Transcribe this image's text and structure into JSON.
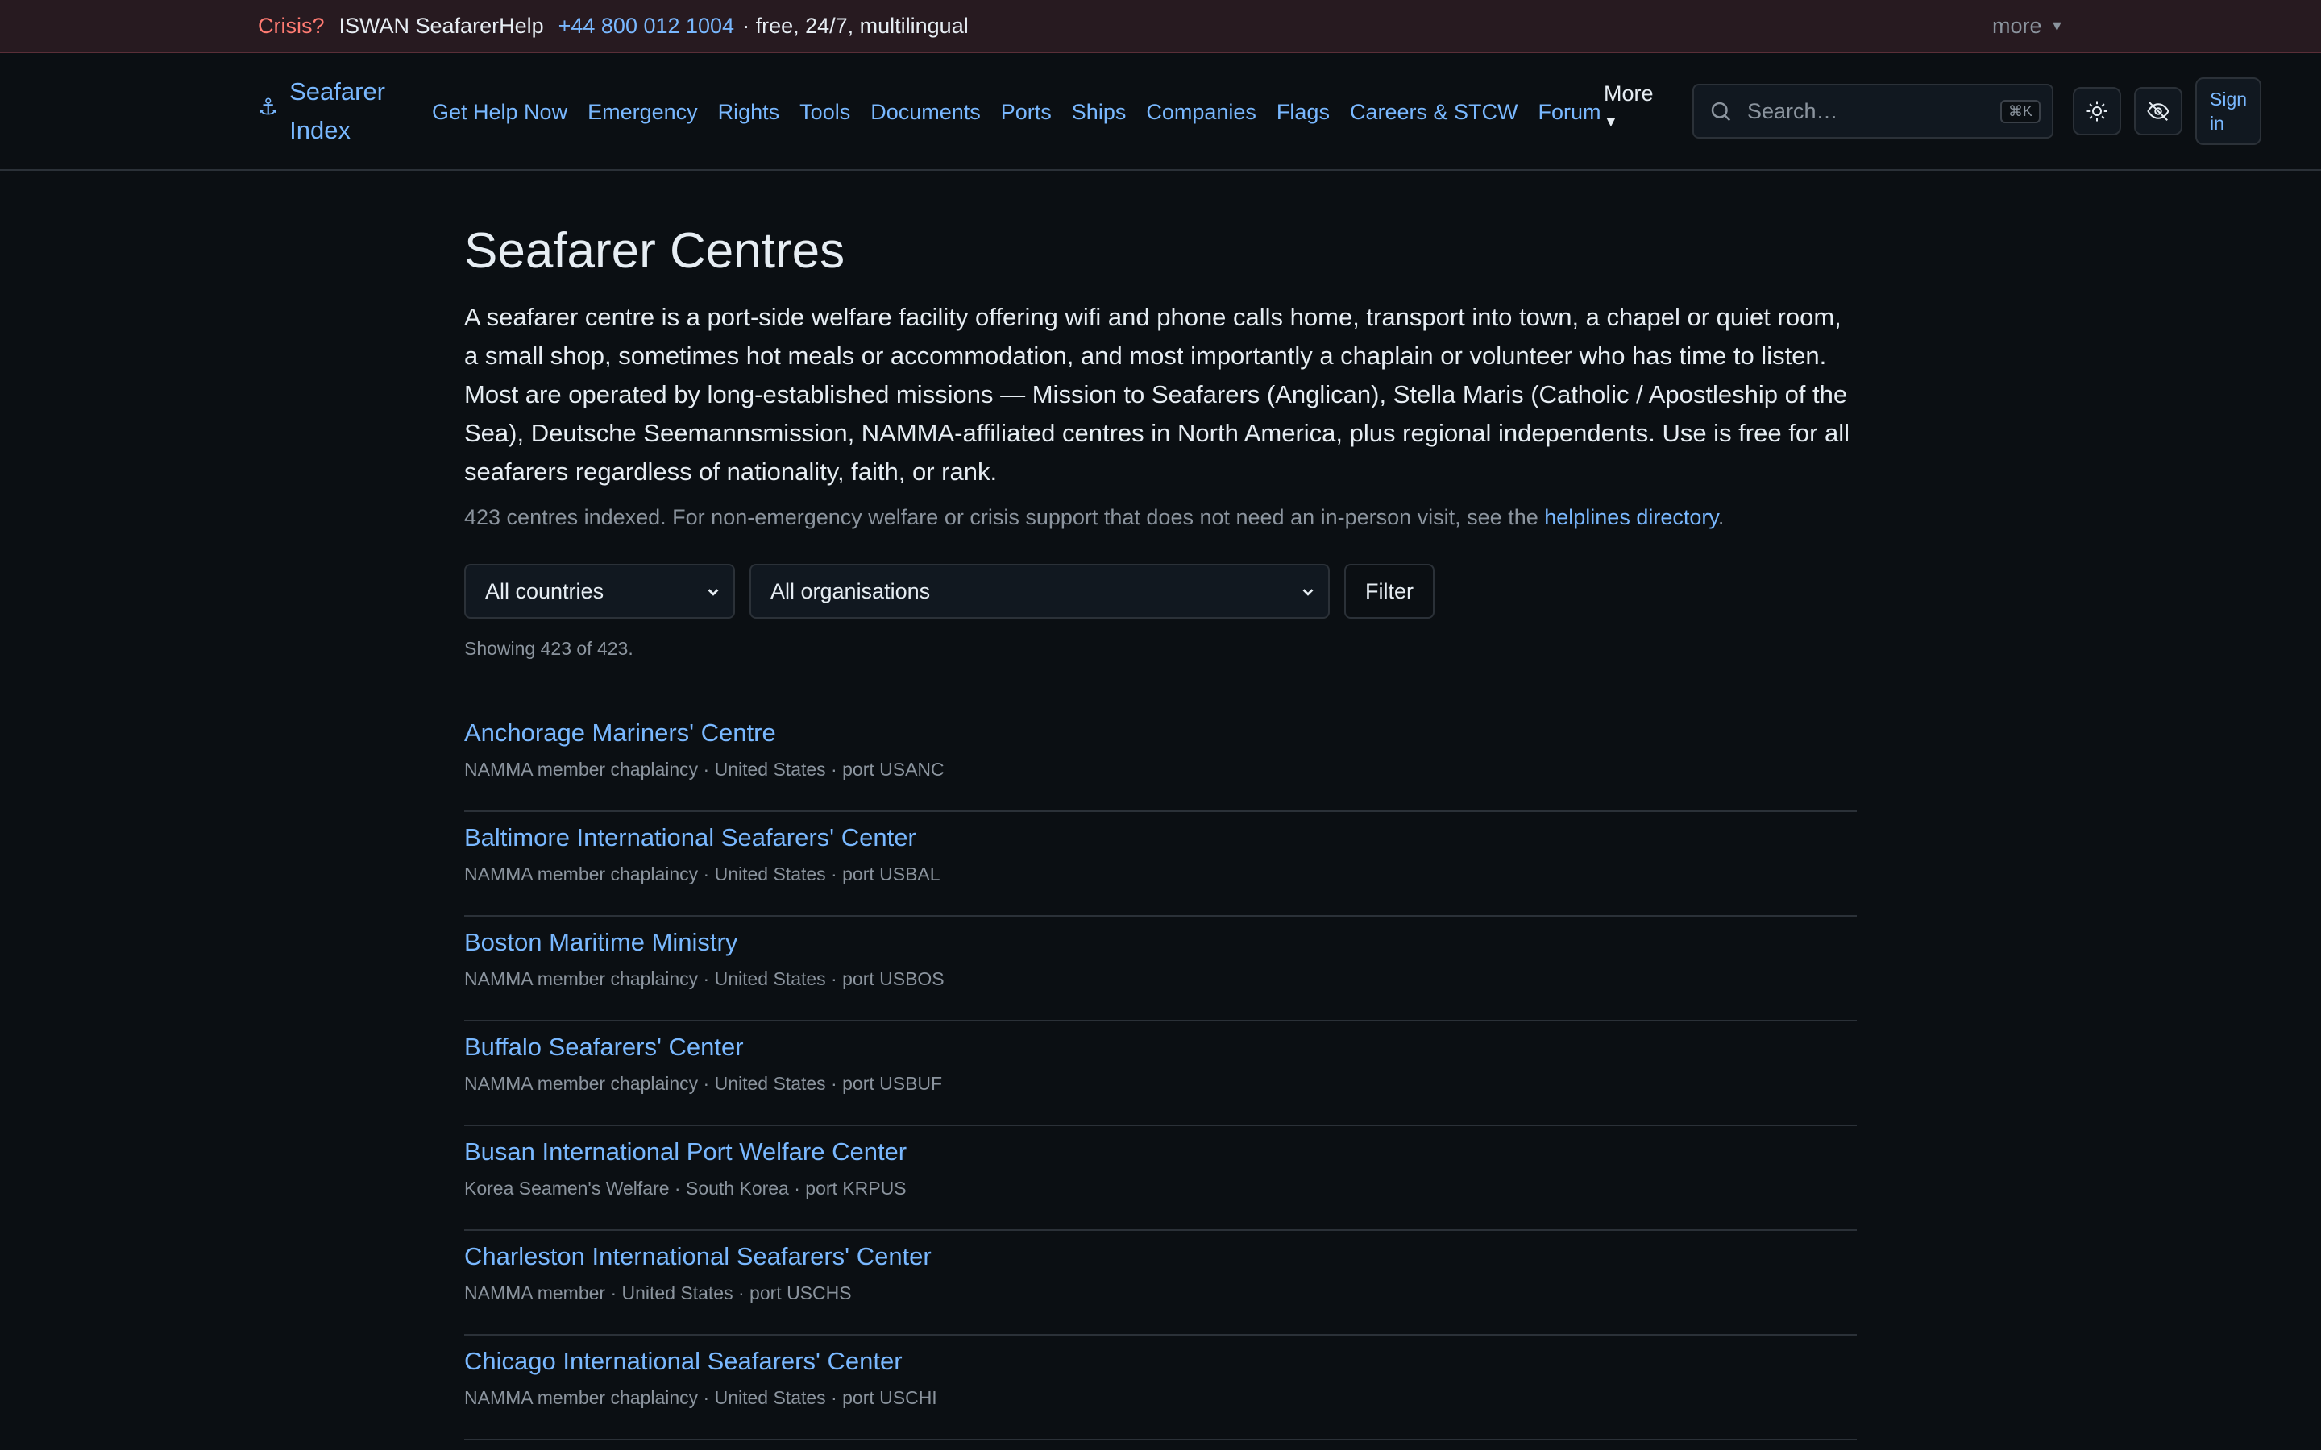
{
  "crisis": {
    "label": "Crisis?",
    "service": "ISWAN SeafarerHelp",
    "phone": "+44 800 012 1004",
    "note": "· free, 24/7, multilingual",
    "more": "more"
  },
  "nav": {
    "brand": "Seafarer Index",
    "links": [
      "Get Help Now",
      "Emergency",
      "Rights",
      "Tools",
      "Documents",
      "Ports",
      "Ships",
      "Companies",
      "Flags",
      "Careers & STCW",
      "Forum"
    ],
    "more": "More",
    "search_placeholder": "Search…",
    "search_kbd": "⌘K",
    "signin": "Sign in"
  },
  "page": {
    "title": "Seafarer Centres",
    "intro": "A seafarer centre is a port-side welfare facility offering wifi and phone calls home, transport into town, a chapel or quiet room, a small shop, sometimes hot meals or accommodation, and most importantly a chaplain or volunteer who has time to listen. Most are operated by long-established missions — Mission to Seafarers (Anglican), Stella Maris (Catholic / Apostleship of the Sea), Deutsche Seemannsmission, NAMMA-affiliated centres in North America, plus regional independents. Use is free for all seafarers regardless of nationality, faith, or rank.",
    "sub_prefix": "423 centres indexed. For non-emergency welfare or crisis support that does not need an in-person visit, see the",
    "sub_link": "helplines directory",
    "sub_suffix": "."
  },
  "filters": {
    "country": "All countries",
    "organisation": "All organisations",
    "button": "Filter",
    "showing": "Showing 423 of 423."
  },
  "centres": [
    {
      "name": "Anchorage Mariners' Centre",
      "meta": "NAMMA member chaplaincy · United States · port USANC"
    },
    {
      "name": "Baltimore International Seafarers' Center",
      "meta": "NAMMA member chaplaincy · United States · port USBAL"
    },
    {
      "name": "Boston Maritime Ministry",
      "meta": "NAMMA member chaplaincy · United States · port USBOS"
    },
    {
      "name": "Buffalo Seafarers' Center",
      "meta": "NAMMA member chaplaincy · United States · port USBUF"
    },
    {
      "name": "Busan International Port Welfare Center",
      "meta": "Korea Seamen's Welfare · South Korea · port KRPUS"
    },
    {
      "name": "Charleston International Seafarers' Center",
      "meta": "NAMMA member · United States · port USCHS"
    },
    {
      "name": "Chicago International Seafarers' Center",
      "meta": "NAMMA member chaplaincy · United States · port USCHI"
    }
  ],
  "icons": {
    "brand": "anchor-icon",
    "search": "search-icon",
    "theme": "sun-icon",
    "visibility": "eye-off-icon"
  },
  "colors": {
    "background": "#0b0f13",
    "link": "#79b8ff",
    "crisis": "#ff7b72",
    "muted": "#8b949e",
    "border": "#2b3138"
  }
}
